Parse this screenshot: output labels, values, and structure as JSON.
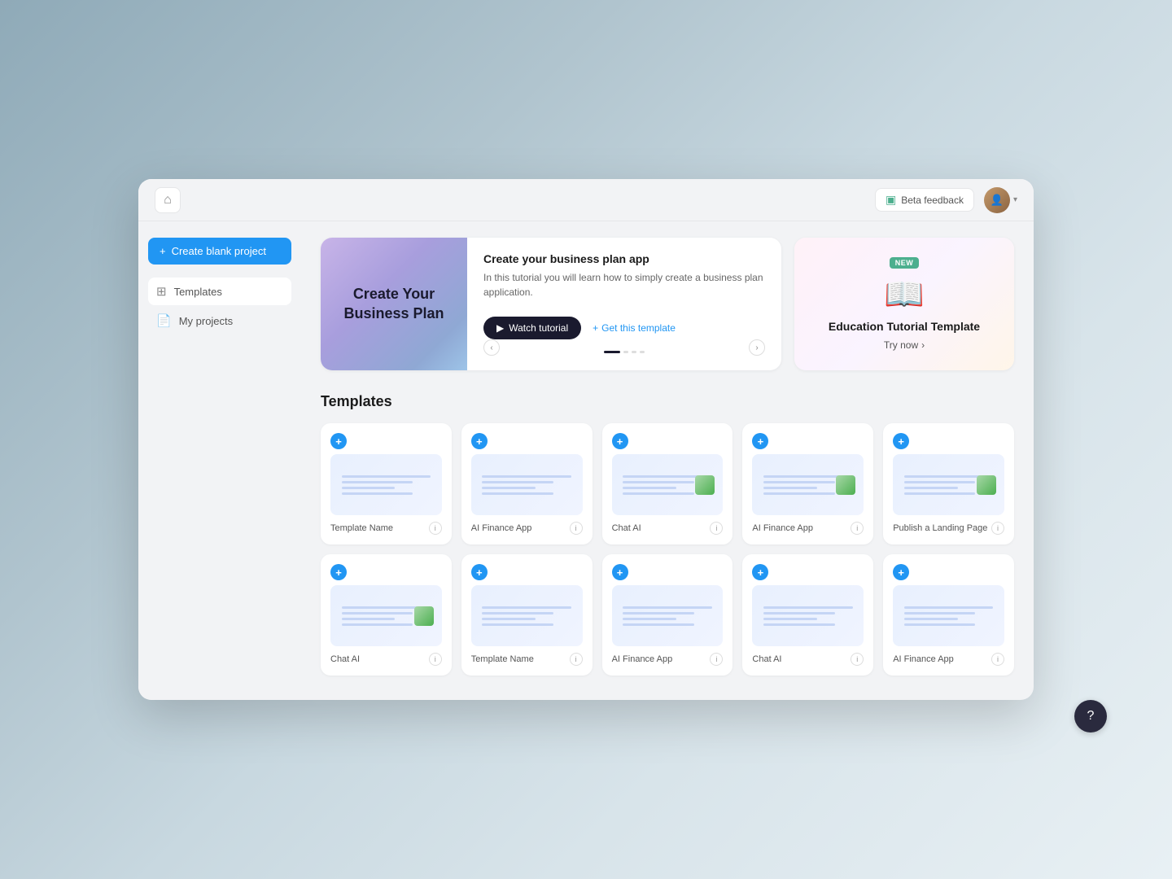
{
  "topbar": {
    "feedback_label": "Beta feedback",
    "home_icon": "🏠"
  },
  "sidebar": {
    "create_btn": "Create blank project",
    "items": [
      {
        "id": "templates",
        "label": "Templates",
        "icon": "⊞",
        "active": true
      },
      {
        "id": "my-projects",
        "label": "My projects",
        "icon": "📄",
        "active": false
      }
    ]
  },
  "hero": {
    "tutorial": {
      "title": "Create Your Business Plan",
      "heading": "Create your business plan app",
      "description": "In this tutorial you will learn how to simply create a business plan application.",
      "watch_label": "Watch tutorial",
      "get_template_label": "Get this template"
    },
    "education": {
      "badge": "NEW",
      "title": "Education Tutorial Template",
      "try_label": "Try now"
    }
  },
  "templates_section": {
    "title": "Templates",
    "row1": [
      {
        "name": "Template Name",
        "has_image": false
      },
      {
        "name": "AI Finance App",
        "has_image": false
      },
      {
        "name": "Chat AI",
        "has_image": true
      },
      {
        "name": "AI Finance App",
        "has_image": true
      },
      {
        "name": "Publish a Landing Page",
        "has_image": true
      }
    ],
    "row2": [
      {
        "name": "Chat AI",
        "has_image": true
      },
      {
        "name": "Template Name",
        "has_image": false
      },
      {
        "name": "AI Finance App",
        "has_image": false
      },
      {
        "name": "Chat AI",
        "has_image": false
      },
      {
        "name": "AI Finance App",
        "has_image": false
      }
    ]
  },
  "help": {
    "label": "?"
  }
}
